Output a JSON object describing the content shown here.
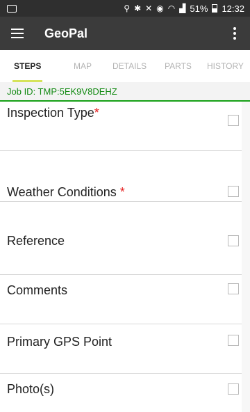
{
  "status_bar": {
    "time": "12:32",
    "battery": "51%",
    "icons": [
      "location-icon",
      "bluetooth-icon",
      "mute-icon",
      "alarm-icon",
      "wifi-icon",
      "signal-icon",
      "battery-icon"
    ]
  },
  "app_bar": {
    "title": "GeoPal",
    "menu_icon": "hamburger-menu-icon",
    "overflow_icon": "overflow-menu-icon"
  },
  "tabs": [
    {
      "label": "STEPS",
      "active": true
    },
    {
      "label": "MAP",
      "active": false
    },
    {
      "label": "DETAILS",
      "active": false
    },
    {
      "label": "PARTS",
      "active": false
    },
    {
      "label": "HISTORY",
      "active": false
    }
  ],
  "job": {
    "id_text": "Job ID: TMP:5EK9V8DEHZ"
  },
  "steps": [
    {
      "label": "Inspection Type",
      "required_mark": "*",
      "checked": false
    },
    {
      "label": "Weather Conditions ",
      "required_mark": "*",
      "checked": false
    },
    {
      "label": "Reference",
      "required_mark": "",
      "checked": false
    },
    {
      "label": "Comments",
      "required_mark": "",
      "checked": false
    },
    {
      "label": "Primary GPS Point",
      "required_mark": "",
      "checked": false
    },
    {
      "label": "Photo(s)",
      "required_mark": "",
      "checked": false
    }
  ],
  "colors": {
    "app_bar": "#3b3b3b",
    "tab_indicator": "#d6e35a",
    "job_text": "#138a13",
    "required": "#e51b1b"
  }
}
